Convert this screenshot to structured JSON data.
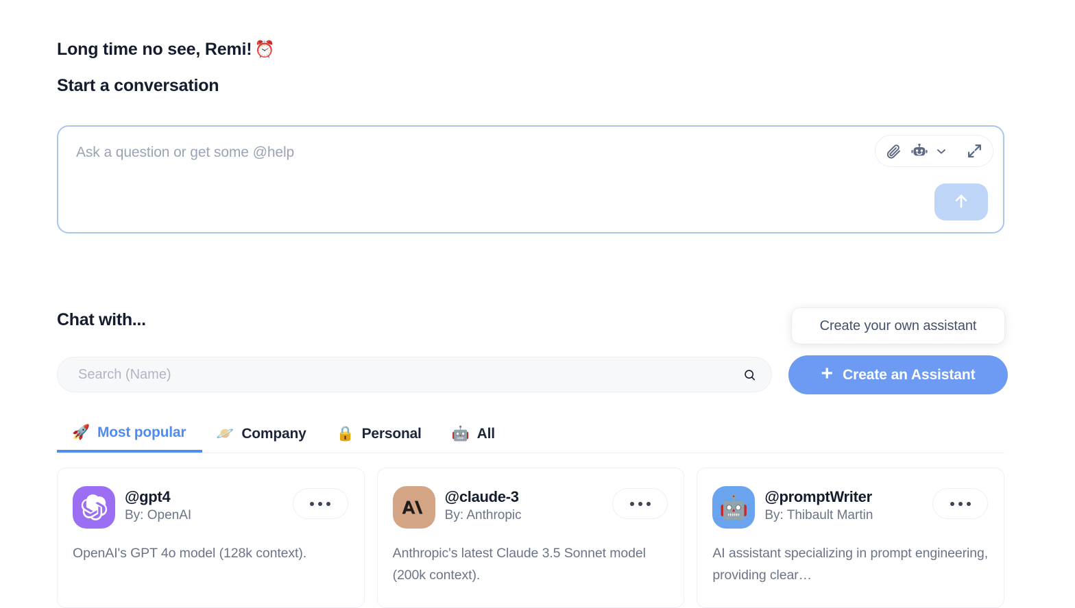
{
  "greeting": {
    "text": "Long time no see, Remi!",
    "emoji": "⏰"
  },
  "subheading": "Start a conversation",
  "composer": {
    "placeholder": "Ask a question or get some @help",
    "attach_icon": "paperclip-icon",
    "assistant_icon": "robot-icon",
    "chevron_icon": "chevron-down-icon",
    "expand_icon": "expand-arrows-icon",
    "send_icon": "arrow-up-icon",
    "border_color": "#a9c4ef",
    "send_bg": "#bed5f7"
  },
  "chat_with": {
    "title": "Chat with..."
  },
  "search": {
    "placeholder": "Search (Name)",
    "value": "",
    "icon": "search-icon"
  },
  "tooltip": {
    "text": "Create your own assistant"
  },
  "cta": {
    "plus": "+",
    "label": "Create an Assistant",
    "color": "#6d9bf3"
  },
  "tabs": [
    {
      "label": "Most popular",
      "icon": "🚀",
      "icon_name": "rocket-icon",
      "active": true
    },
    {
      "label": "Company",
      "icon": "🪐",
      "icon_name": "planet-icon",
      "active": false
    },
    {
      "label": "Personal",
      "icon": "🔒",
      "icon_name": "lock-icon",
      "active": false
    },
    {
      "label": "All",
      "icon": "🤖",
      "icon_name": "robot-icon",
      "active": false
    }
  ],
  "cards": [
    {
      "handle": "@gpt4",
      "by": "By: OpenAI",
      "description": "OpenAI's GPT 4o model (128k context).",
      "avatar_kind": "openai-logo",
      "avatar_bg": "#9b6ef3",
      "more_label": "..."
    },
    {
      "handle": "@claude-3",
      "by": "By: Anthropic",
      "description": "Anthropic's latest Claude 3.5 Sonnet model (200k context).",
      "avatar_kind": "anthropic-logo",
      "avatar_bg": "#d4a585",
      "more_label": "..."
    },
    {
      "handle": "@promptWriter",
      "by": "By: Thibault Martin",
      "description": "AI assistant specializing in prompt engineering, providing clear…",
      "avatar_kind": "robot-emoji",
      "avatar_bg": "#6aa3ee",
      "avatar_glyph": "🤖",
      "more_label": "..."
    }
  ]
}
